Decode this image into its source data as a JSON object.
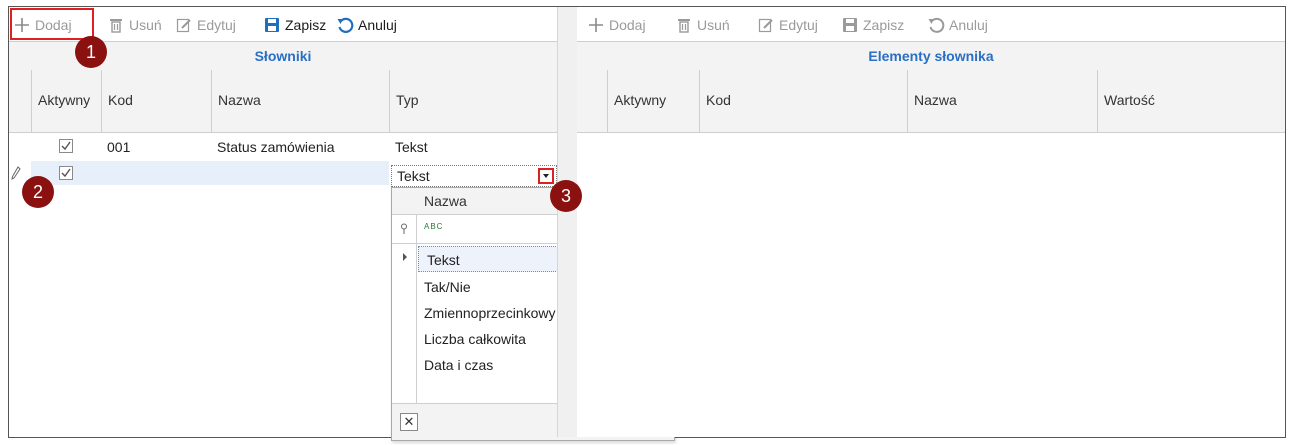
{
  "left": {
    "toolbar": {
      "add_label": "Dodaj",
      "delete_label": "Usuń",
      "edit_label": "Edytuj",
      "save_label": "Zapisz",
      "cancel_label": "Anuluj"
    },
    "caption": "Słowniki",
    "columns": [
      "Aktywny",
      "Kod",
      "Nazwa",
      "Typ"
    ],
    "rows": [
      {
        "active": true,
        "code": "001",
        "name": "Status zamówienia",
        "type": "Tekst"
      },
      {
        "active": true,
        "code": "",
        "name": "",
        "type": "Tekst"
      }
    ]
  },
  "right": {
    "toolbar": {
      "add_label": "Dodaj",
      "delete_label": "Usuń",
      "edit_label": "Edytuj",
      "save_label": "Zapisz",
      "cancel_label": "Anuluj"
    },
    "caption": "Elementy słownika",
    "columns": [
      "Aktywny",
      "Kod",
      "Nazwa",
      "Wartość"
    ]
  },
  "dropdown": {
    "header": "Nazwa",
    "filter_icon_text": "ABC",
    "options": [
      "Tekst",
      "Tak/Nie",
      "Zmiennoprzecinkowy",
      "Liczba całkowita",
      "Data i czas"
    ],
    "selected": "Tekst",
    "clear_glyph": "✕"
  },
  "callouts": [
    "1",
    "2",
    "3"
  ],
  "colors": {
    "caption_text": "#2a6fc6",
    "callout_fill": "#8b1111",
    "highlight_border": "#e02020",
    "save_icon": "#1f6fc0"
  }
}
